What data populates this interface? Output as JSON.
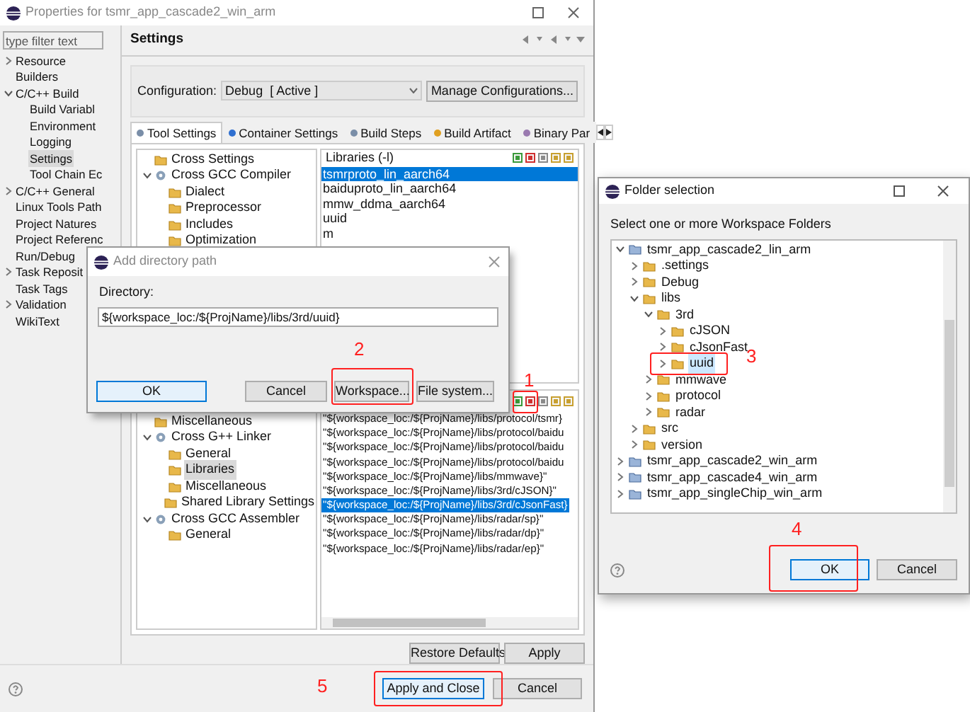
{
  "window": {
    "title": "Properties for tsmr_app_cascade2_win_arm"
  },
  "sidebar": {
    "placeholder": "type filter text",
    "items": [
      {
        "label": "Resource",
        "expanded": false,
        "selected": false
      },
      {
        "label": "Builders",
        "selected": false
      },
      {
        "label": "C/C++ Build",
        "expanded": true,
        "selected": false,
        "children": [
          {
            "label": "Build Variabl",
            "selected": false
          },
          {
            "label": "Environment",
            "selected": false
          },
          {
            "label": "Logging",
            "selected": false
          },
          {
            "label": "Settings",
            "selected": true
          },
          {
            "label": "Tool Chain Ec",
            "selected": false
          }
        ]
      },
      {
        "label": "C/C++ General",
        "expanded": false,
        "selected": false
      },
      {
        "label": "Linux Tools Path",
        "selected": false
      },
      {
        "label": "Project Natures",
        "selected": false
      },
      {
        "label": "Project Referenc",
        "selected": false
      },
      {
        "label": "Run/Debug",
        "selected": false
      },
      {
        "label": "Task Reposit",
        "expanded": false,
        "selected": false
      },
      {
        "label": "Task Tags",
        "selected": false
      },
      {
        "label": "Validation",
        "expanded": false,
        "selected": false
      },
      {
        "label": "WikiText",
        "selected": false
      }
    ]
  },
  "page": {
    "title": "Settings"
  },
  "configuration": {
    "label": "Configuration:",
    "value": "Debug  [ Active ]",
    "button": "Manage Configurations..."
  },
  "tabs": [
    {
      "label": "Tool Settings",
      "selected": true
    },
    {
      "label": "Container Settings",
      "selected": false
    },
    {
      "label": "Build Steps",
      "selected": false
    },
    {
      "label": "Build Artifact",
      "selected": false
    },
    {
      "label": "Binary Par",
      "selected": false
    }
  ],
  "tool_tree_top": [
    {
      "label": "Cross Settings",
      "kind": "leaf",
      "selected": false
    },
    {
      "label": "Cross GCC Compiler",
      "kind": "tool",
      "expanded": true,
      "selected": false,
      "children": [
        {
          "label": "Dialect",
          "kind": "leaf",
          "selected": false
        },
        {
          "label": "Preprocessor",
          "kind": "leaf",
          "selected": false
        },
        {
          "label": "Includes",
          "kind": "leaf",
          "selected": false
        },
        {
          "label": "Optimization",
          "kind": "leaf",
          "selected": false
        }
      ]
    }
  ],
  "tool_tree_bottom": [
    {
      "label": "Miscellaneous",
      "kind": "leaf",
      "selected": false
    },
    {
      "label": "Cross G++ Linker",
      "kind": "tool",
      "expanded": true,
      "selected": false,
      "children": [
        {
          "label": "General",
          "kind": "leaf",
          "selected": false
        },
        {
          "label": "Libraries",
          "kind": "leaf",
          "selected": true
        },
        {
          "label": "Miscellaneous",
          "kind": "leaf",
          "selected": false
        },
        {
          "label": "Shared Library Settings",
          "kind": "leaf",
          "selected": false
        }
      ]
    },
    {
      "label": "Cross GCC Assembler",
      "kind": "tool",
      "expanded": true,
      "selected": false,
      "children": [
        {
          "label": "General",
          "kind": "leaf",
          "selected": false
        }
      ]
    }
  ],
  "libraries": {
    "title": "Libraries (-l)",
    "items": [
      {
        "text": "tsmrproto_lin_aarch64",
        "selected": true
      },
      {
        "text": "baiduproto_lin_aarch64",
        "selected": false
      },
      {
        "text": "mmw_ddma_aarch64",
        "selected": false
      },
      {
        "text": "uuid",
        "selected": false
      },
      {
        "text": "m",
        "selected": false
      }
    ]
  },
  "library_paths": {
    "items": [
      {
        "text": "\"${workspace_loc:/${ProjName}/libs/protocol/tsmr}",
        "selected": false
      },
      {
        "text": "\"${workspace_loc:/${ProjName}/libs/protocol/baidu",
        "selected": false
      },
      {
        "text": "\"${workspace_loc:/${ProjName}/libs/protocol/baidu",
        "selected": false
      },
      {
        "text": "\"${workspace_loc:/${ProjName}/libs/protocol/baidu",
        "selected": false
      },
      {
        "text": "\"${workspace_loc:/${ProjName}/libs/mmwave}\"",
        "selected": false
      },
      {
        "text": "\"${workspace_loc:/${ProjName}/libs/3rd/cJSON}\"",
        "selected": false
      },
      {
        "text": "\"${workspace_loc:/${ProjName}/libs/3rd/cJsonFast}",
        "selected": true
      },
      {
        "text": "\"${workspace_loc:/${ProjName}/libs/radar/sp}\"",
        "selected": false
      },
      {
        "text": "\"${workspace_loc:/${ProjName}/libs/radar/dp}\"",
        "selected": false
      },
      {
        "text": "\"${workspace_loc:/${ProjName}/libs/radar/ep}\"",
        "selected": false
      }
    ]
  },
  "panel_buttons": [
    "Restore Defaults",
    "Apply"
  ],
  "footer_buttons": [
    "Apply and Close",
    "Cancel"
  ],
  "add_directory_dialog": {
    "title": "Add directory path",
    "label": "Directory:",
    "value": "${workspace_loc:/${ProjName}/libs/3rd/uuid}",
    "buttons": [
      "OK",
      "Cancel",
      "Workspace...",
      "File system..."
    ]
  },
  "folder_dialog": {
    "title": "Folder selection",
    "prompt": "Select one or more Workspace Folders",
    "tree": [
      {
        "label": "tsmr_app_cascade2_lin_arm",
        "kind": "project",
        "expanded": true,
        "selected": false,
        "children": [
          {
            "label": ".settings",
            "kind": "folder",
            "expanded": false,
            "selected": false
          },
          {
            "label": "Debug",
            "kind": "folder",
            "expanded": false,
            "selected": false
          },
          {
            "label": "libs",
            "kind": "folder",
            "expanded": true,
            "selected": false,
            "children": [
              {
                "label": "3rd",
                "kind": "folder",
                "expanded": true,
                "selected": false,
                "children": [
                  {
                    "label": "cJSON",
                    "kind": "folder",
                    "expanded": false,
                    "selected": false
                  },
                  {
                    "label": "cJsonFast",
                    "kind": "folder",
                    "expanded": false,
                    "selected": false
                  },
                  {
                    "label": "uuid",
                    "kind": "folder",
                    "expanded": false,
                    "selected": true
                  }
                ]
              },
              {
                "label": "mmwave",
                "kind": "folder",
                "expanded": false,
                "selected": false
              },
              {
                "label": "protocol",
                "kind": "folder",
                "expanded": false,
                "selected": false
              },
              {
                "label": "radar",
                "kind": "folder",
                "expanded": false,
                "selected": false
              }
            ]
          },
          {
            "label": "src",
            "kind": "folder",
            "expanded": false,
            "selected": false
          },
          {
            "label": "version",
            "kind": "folder",
            "expanded": false,
            "selected": false
          }
        ]
      },
      {
        "label": "tsmr_app_cascade2_win_arm",
        "kind": "project",
        "expanded": false,
        "selected": false
      },
      {
        "label": "tsmr_app_cascade4_win_arm",
        "kind": "project",
        "expanded": false,
        "selected": false
      },
      {
        "label": "tsmr_app_singleChip_win_arm",
        "kind": "project",
        "expanded": false,
        "selected": false
      }
    ],
    "buttons": [
      "OK",
      "Cancel"
    ]
  },
  "annotations": [
    "1",
    "2",
    "3",
    "4",
    "5"
  ]
}
